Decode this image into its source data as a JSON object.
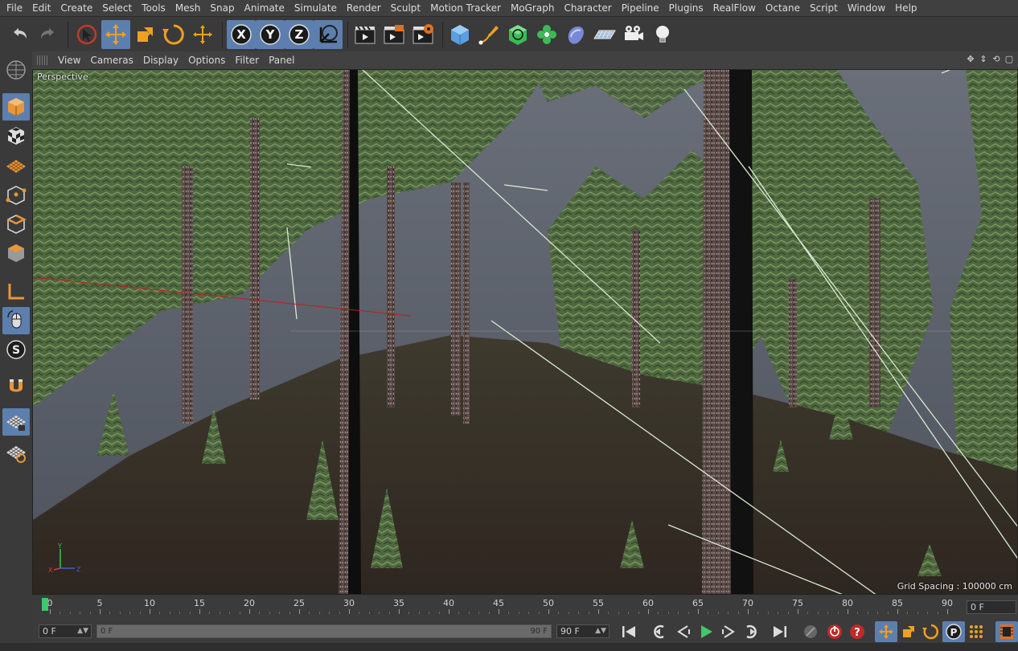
{
  "menu": [
    "File",
    "Edit",
    "Create",
    "Select",
    "Tools",
    "Mesh",
    "Snap",
    "Animate",
    "Simulate",
    "Render",
    "Sculpt",
    "Motion Tracker",
    "MoGraph",
    "Character",
    "Pipeline",
    "Plugins",
    "RealFlow",
    "Octane",
    "Script",
    "Window",
    "Help"
  ],
  "toolbar_icons": [
    "undo-icon",
    "redo-icon",
    "live-selection-icon",
    "move-icon",
    "scale-icon",
    "rotate-icon",
    "recent-tool-icon",
    "x-axis-lock-icon",
    "y-axis-lock-icon",
    "z-axis-lock-icon",
    "coordinate-system-icon",
    "render-view-icon",
    "render-to-picture-viewer-icon",
    "edit-render-settings-icon",
    "cube-icon",
    "pen-spline-icon",
    "subdivision-surface-icon",
    "cloner-icon",
    "deformer-icon",
    "floor-icon",
    "camera-icon",
    "light-icon"
  ],
  "viewport": {
    "menu": [
      "View",
      "Cameras",
      "Display",
      "Options",
      "Filter",
      "Panel"
    ],
    "label": "Perspective",
    "grid_spacing": "Grid Spacing : 100000 cm",
    "axis": {
      "y": "Y",
      "x": "X",
      "z": "Z"
    }
  },
  "timeline": {
    "ticks": [
      "0",
      "5",
      "10",
      "15",
      "20",
      "25",
      "30",
      "35",
      "40",
      "45",
      "50",
      "55",
      "60",
      "65",
      "70",
      "75",
      "80",
      "85",
      "90"
    ],
    "current_frame_right": "0 F"
  },
  "transport": {
    "start_field": "0 F",
    "range_start": "0 F",
    "range_end": "90 F",
    "end_field": "90 F"
  },
  "colors": {
    "accent": "#5d7fae",
    "playhead": "#3ec86a",
    "sky": "#5a5f6a",
    "foliage": "#58704a",
    "ground": "#3a3028"
  }
}
